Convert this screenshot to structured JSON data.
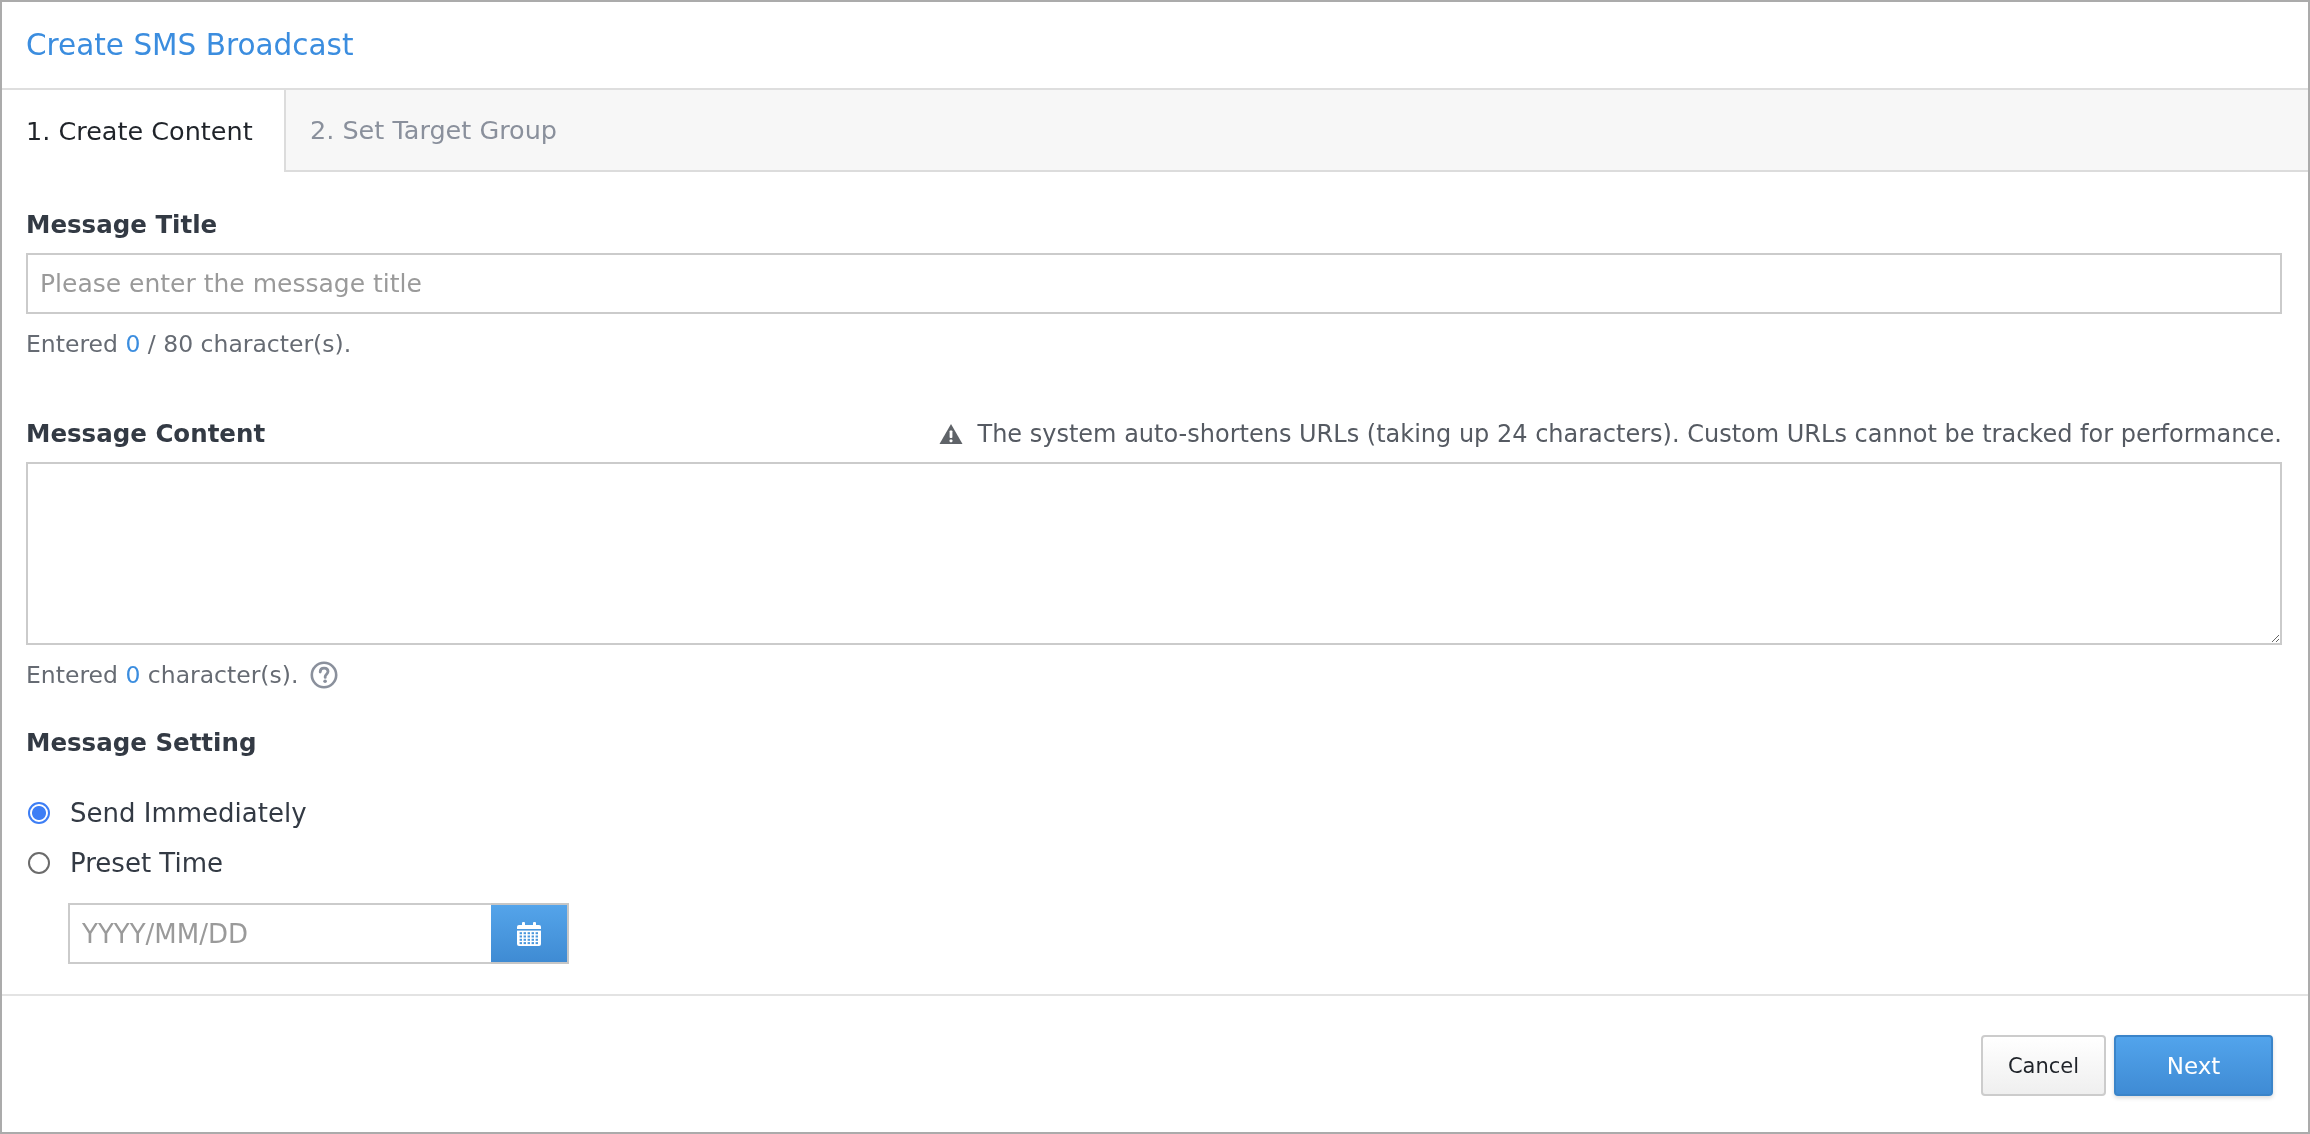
{
  "window": {
    "title": "Create SMS Broadcast"
  },
  "tabs": [
    {
      "label": "1. Create Content",
      "selected": true
    },
    {
      "label": "2. Set Target Group",
      "selected": false
    }
  ],
  "message_title": {
    "label": "Message Title",
    "placeholder": "Please enter the message title",
    "counter": {
      "before": "Entered",
      "count": "0",
      "after": "/ 80 character(s)."
    }
  },
  "message_content": {
    "label": "Message Content",
    "notice": "The system auto-shortens URLs (taking up 24 characters). Custom URLs cannot be tracked for performance.",
    "counter": {
      "before": "Entered",
      "count": "0",
      "after": "character(s)."
    }
  },
  "message_setting": {
    "label": "Message Setting",
    "options": [
      {
        "label": "Send Immediately",
        "selected": true
      },
      {
        "label": "Preset Time",
        "selected": false
      }
    ],
    "date_field": {
      "placeholder": "YYYY/MM/DD"
    }
  },
  "buttons": [
    {
      "label": "Cancel",
      "kind": "secondary"
    },
    {
      "label": "Next",
      "kind": "primary"
    }
  ]
}
